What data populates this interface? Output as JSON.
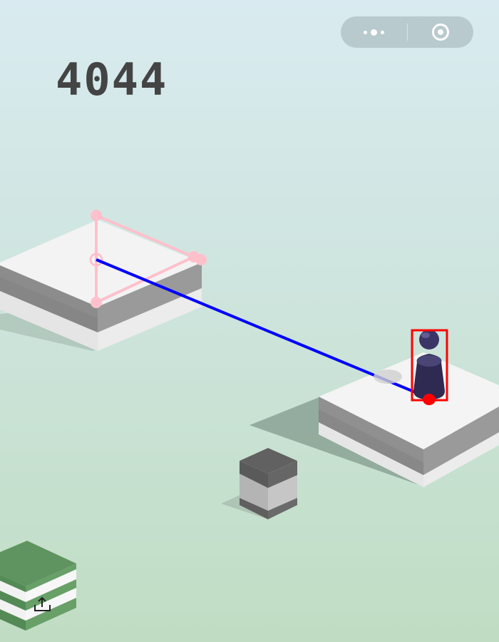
{
  "game": {
    "score": "4044"
  },
  "capsule": {
    "menu_icon": "more-dots-icon",
    "close_icon": "target-circle-icon"
  },
  "share": {
    "icon": "share-upload-icon"
  },
  "colors": {
    "score": "#444444",
    "platform_top": "#f5f5f5",
    "platform_side": "#8c8c8c",
    "green_block": "#5f9460",
    "dark_block": "#5f5f5f",
    "annotation_pink": "#ffc0cb",
    "trajectory_line": "#0000ff",
    "target_box": "#ff0000",
    "piece": "#2e2a52"
  }
}
